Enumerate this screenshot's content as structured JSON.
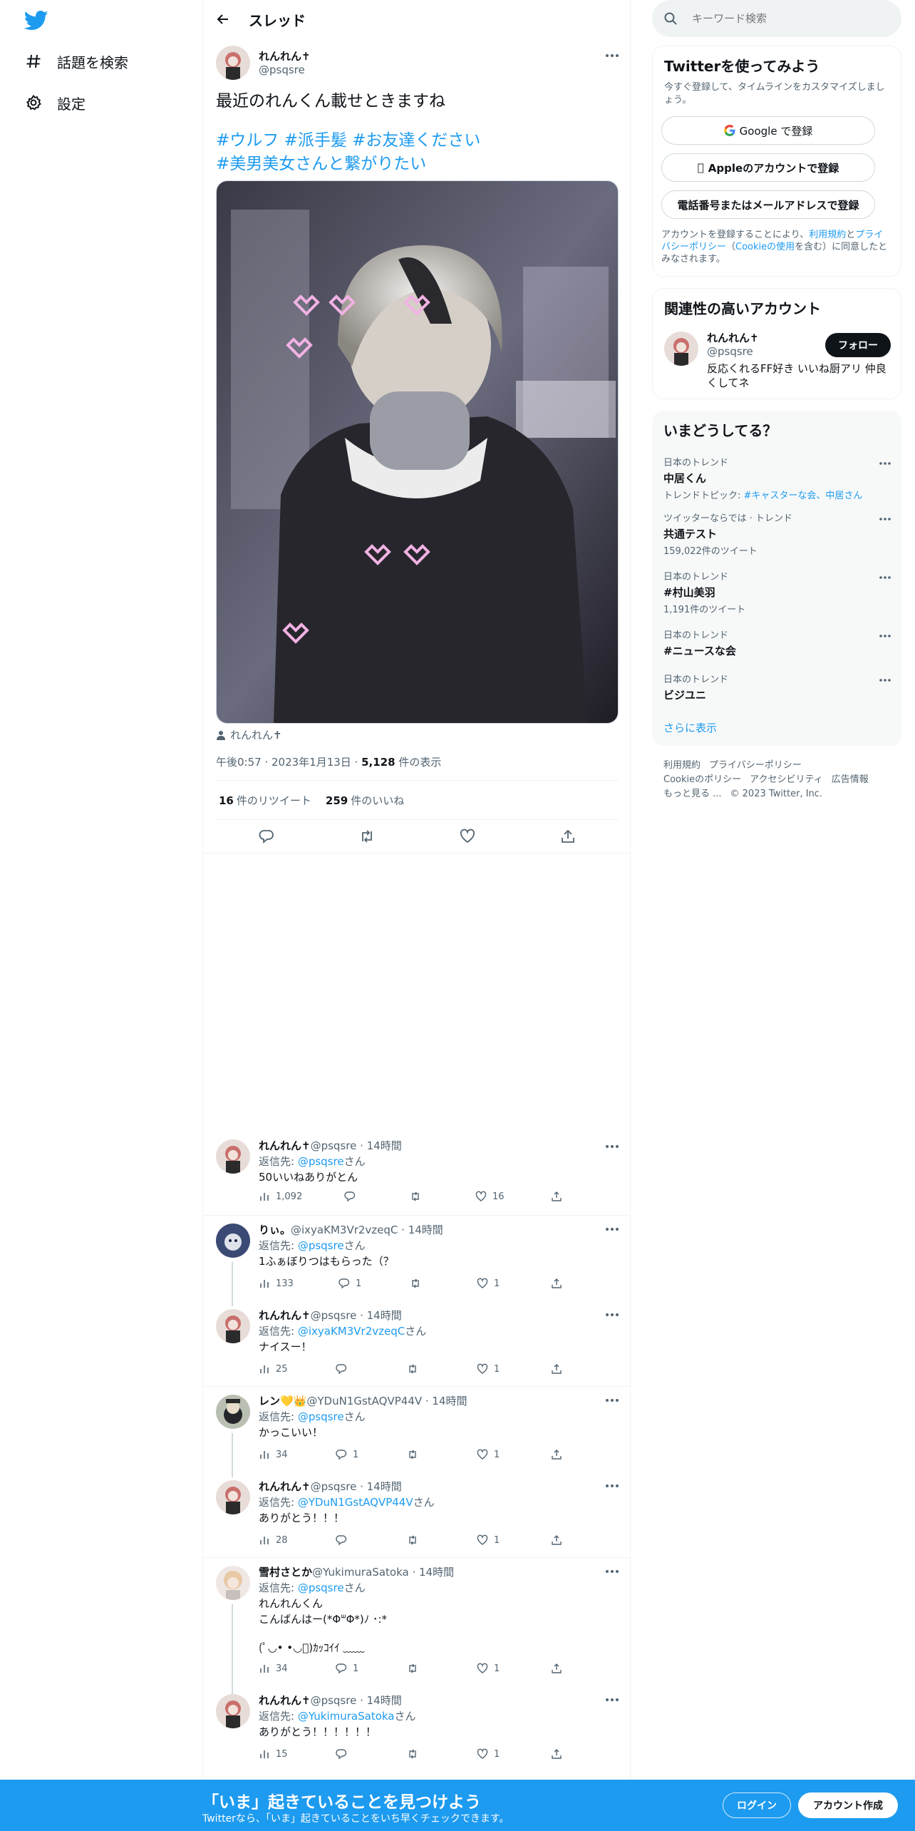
{
  "nav": {
    "explore_label": "話題を検索",
    "settings_label": "設定"
  },
  "header": {
    "title": "スレッド"
  },
  "main_tweet": {
    "name": "れんれん✝",
    "handle": "@psqsre",
    "text_line1": "最近のれんくん載せときますね",
    "hashtags_line1": "#ウルフ #派手髪 #お友達ください",
    "hashtags_line2": "#美男美女さんと繋がりたい",
    "tagged": "れんれん✝",
    "time": "午後0:57 · 2023年1月13日 · ",
    "views": "5,128",
    "views_suffix": " 件の表示",
    "retweets": "16",
    "retweets_label": "件のリツイート",
    "likes": "259",
    "likes_label": "件のいいね"
  },
  "replies": [
    {
      "name": "れんれん✝",
      "handle": "@psqsre · 14時間",
      "to_prefix": "返信先: ",
      "to": "@psqsre",
      "to_suffix": "さん",
      "text": "50いいねありがとん",
      "views": "1,092",
      "replies": "",
      "likes": "16"
    },
    {
      "name": "りぃ。",
      "handle": "@ixyaKM3Vr2vzeqC · 14時間",
      "to_prefix": "返信先: ",
      "to": "@psqsre",
      "to_suffix": "さん",
      "text": "1ふぁぼりつはもらった（？",
      "views": "133",
      "replies": "1",
      "likes": "1"
    },
    {
      "name": "れんれん✝",
      "handle": "@psqsre · 14時間",
      "to_prefix": "返信先: ",
      "to": "@ixyaKM3Vr2vzeqC",
      "to_suffix": "さん",
      "text": "ナイスー！",
      "views": "25",
      "replies": "",
      "likes": "1"
    },
    {
      "name": "レン💛👑",
      "handle": "@YDuN1GstAQVP44V · 14時間",
      "to_prefix": "返信先: ",
      "to": "@psqsre",
      "to_suffix": "さん",
      "text": "かっこいい！",
      "views": "34",
      "replies": "1",
      "likes": "1"
    },
    {
      "name": "れんれん✝",
      "handle": "@psqsre · 14時間",
      "to_prefix": "返信先: ",
      "to": "@YDuN1GstAQVP44V",
      "to_suffix": "さん",
      "text": "ありがとう！！！",
      "views": "28",
      "replies": "",
      "likes": "1"
    },
    {
      "name": "雪村さとか",
      "handle": "@YukimuraSatoka · 14時間",
      "to_prefix": "返信先: ",
      "to": "@psqsre",
      "to_suffix": "さん",
      "text": "れんれんくん",
      "text2": "こんばんはー(*ΦᐜΦ*)ﾉ ･:*",
      "text3": "(ﾟ◡• •◡ﾟ)ｶｯｺｲｲ ﹏﹏",
      "views": "34",
      "replies": "1",
      "likes": "1"
    },
    {
      "name": "れんれん✝",
      "handle": "@psqsre · 14時間",
      "to_prefix": "返信先: ",
      "to": "@YukimuraSatoka",
      "to_suffix": "さん",
      "text": "ありがとう！！！！！！",
      "views": "15",
      "replies": "",
      "likes": "1"
    }
  ],
  "search": {
    "placeholder": "キーワード検索"
  },
  "signup": {
    "title": "Twitterを使ってみよう",
    "subtitle": "今すぐ登録して、タイムラインをカスタマイズしましょう。",
    "google": "Google で登録",
    "apple": "Appleのアカウントで登録",
    "phone": "電話番号またはメールアドレスで登録",
    "legal_a": "アカウントを登録することにより、",
    "legal_tos": "利用規約",
    "legal_b": "と",
    "legal_pp": "プライバシーポリシー",
    "legal_c": "（",
    "legal_cookie": "Cookieの使用",
    "legal_d": "を含む）に同意したとみなされます。"
  },
  "related": {
    "title": "関連性の高いアカウント",
    "name": "れんれん✝",
    "handle": "@psqsre",
    "follow": "フォロー",
    "bio": "反応くれるFF好き いいね厨アリ 仲良くしてネ"
  },
  "trends": {
    "title": "いまどうしてる？",
    "items": [
      {
        "context": "日本のトレンド",
        "name": "中居くん",
        "extra_prefix": "トレンドトピック: ",
        "extra_link": "#キャスターな会、中居さん"
      },
      {
        "context": "ツイッターならでは · トレンド",
        "name": "共通テスト",
        "count": "159,022件のツイート"
      },
      {
        "context": "日本のトレンド",
        "name": "#村山美羽",
        "count": "1,191件のツイート"
      },
      {
        "context": "日本のトレンド",
        "name": "#ニュースな会"
      },
      {
        "context": "日本のトレンド",
        "name": "ビジユニ"
      }
    ],
    "show_more": "さらに表示"
  },
  "footer": {
    "tos": "利用規約",
    "privacy": "プライバシーポリシー",
    "cookie": "Cookieのポリシー",
    "accessibility": "アクセシビリティ",
    "ads": "広告情報",
    "more": "もっと見る ...",
    "copyright": "© 2023 Twitter, Inc."
  },
  "banner": {
    "title": "「いま」起きていることを見つけよう",
    "subtitle": "Twitterなら、「いま」起きていることをいち早くチェックできます。",
    "login": "ログイン",
    "signup": "アカウント作成"
  },
  "colors": {
    "accent": "#1d9bf0",
    "text": "#0f1419",
    "muted": "#536471"
  }
}
